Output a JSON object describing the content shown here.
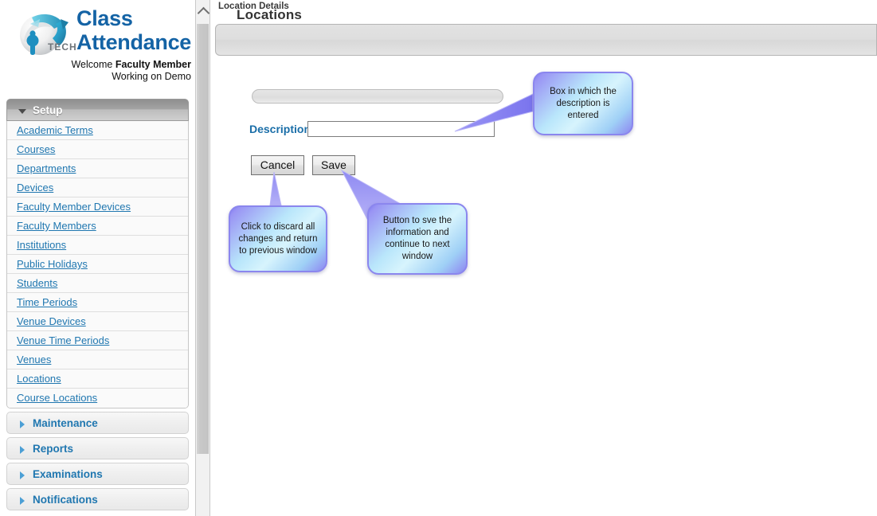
{
  "brand": {
    "logo_icon": "globe-swoosh-logo",
    "logo_wordmark": "iP TECH",
    "title_line1": "Class",
    "title_line2": "Attendance",
    "welcome_prefix": "Welcome ",
    "welcome_user": "Faculty Member",
    "welcome_line2": "Working on Demo"
  },
  "sidebar": {
    "sections": [
      {
        "label": "Setup",
        "expanded": true,
        "icon": "chevron-down-icon",
        "items": [
          {
            "label": "Academic Terms"
          },
          {
            "label": "Courses"
          },
          {
            "label": "Departments"
          },
          {
            "label": "Devices"
          },
          {
            "label": "Faculty Member Devices"
          },
          {
            "label": "Faculty Members"
          },
          {
            "label": "Institutions"
          },
          {
            "label": "Public Holidays"
          },
          {
            "label": "Students"
          },
          {
            "label": "Time Periods"
          },
          {
            "label": "Venue Devices"
          },
          {
            "label": "Venue Time Periods"
          },
          {
            "label": "Venues"
          },
          {
            "label": "Locations"
          },
          {
            "label": "Course Locations"
          }
        ]
      },
      {
        "label": "Maintenance",
        "expanded": false,
        "icon": "chevron-right-icon"
      },
      {
        "label": "Reports",
        "expanded": false,
        "icon": "chevron-right-icon"
      },
      {
        "label": "Examinations",
        "expanded": false,
        "icon": "chevron-right-icon"
      },
      {
        "label": "Notifications",
        "expanded": false,
        "icon": "chevron-right-icon"
      }
    ]
  },
  "scrollbar": {
    "up_icon": "chevron-up-icon"
  },
  "main": {
    "page_title": "Locations",
    "section_title": "Location Details",
    "form": {
      "description_label": "Description",
      "description_value": "",
      "description_placeholder": ""
    },
    "buttons": {
      "cancel": "Cancel",
      "save": "Save"
    }
  },
  "callouts": [
    {
      "id": "description",
      "text": "Box in which the\ndescription is\nentered"
    },
    {
      "id": "cancel",
      "text": "Click to discard all\nchanges and return\nto previous window"
    },
    {
      "id": "save",
      "text": "Button to sve the\ninformation and\ncontinue to next\nwindow"
    }
  ],
  "colors": {
    "link": "#2077b0",
    "brand": "#1463a5",
    "callout_border": "#8b86ee",
    "callout_fill": "#b9e6fb",
    "label": "#1a6ea8"
  }
}
